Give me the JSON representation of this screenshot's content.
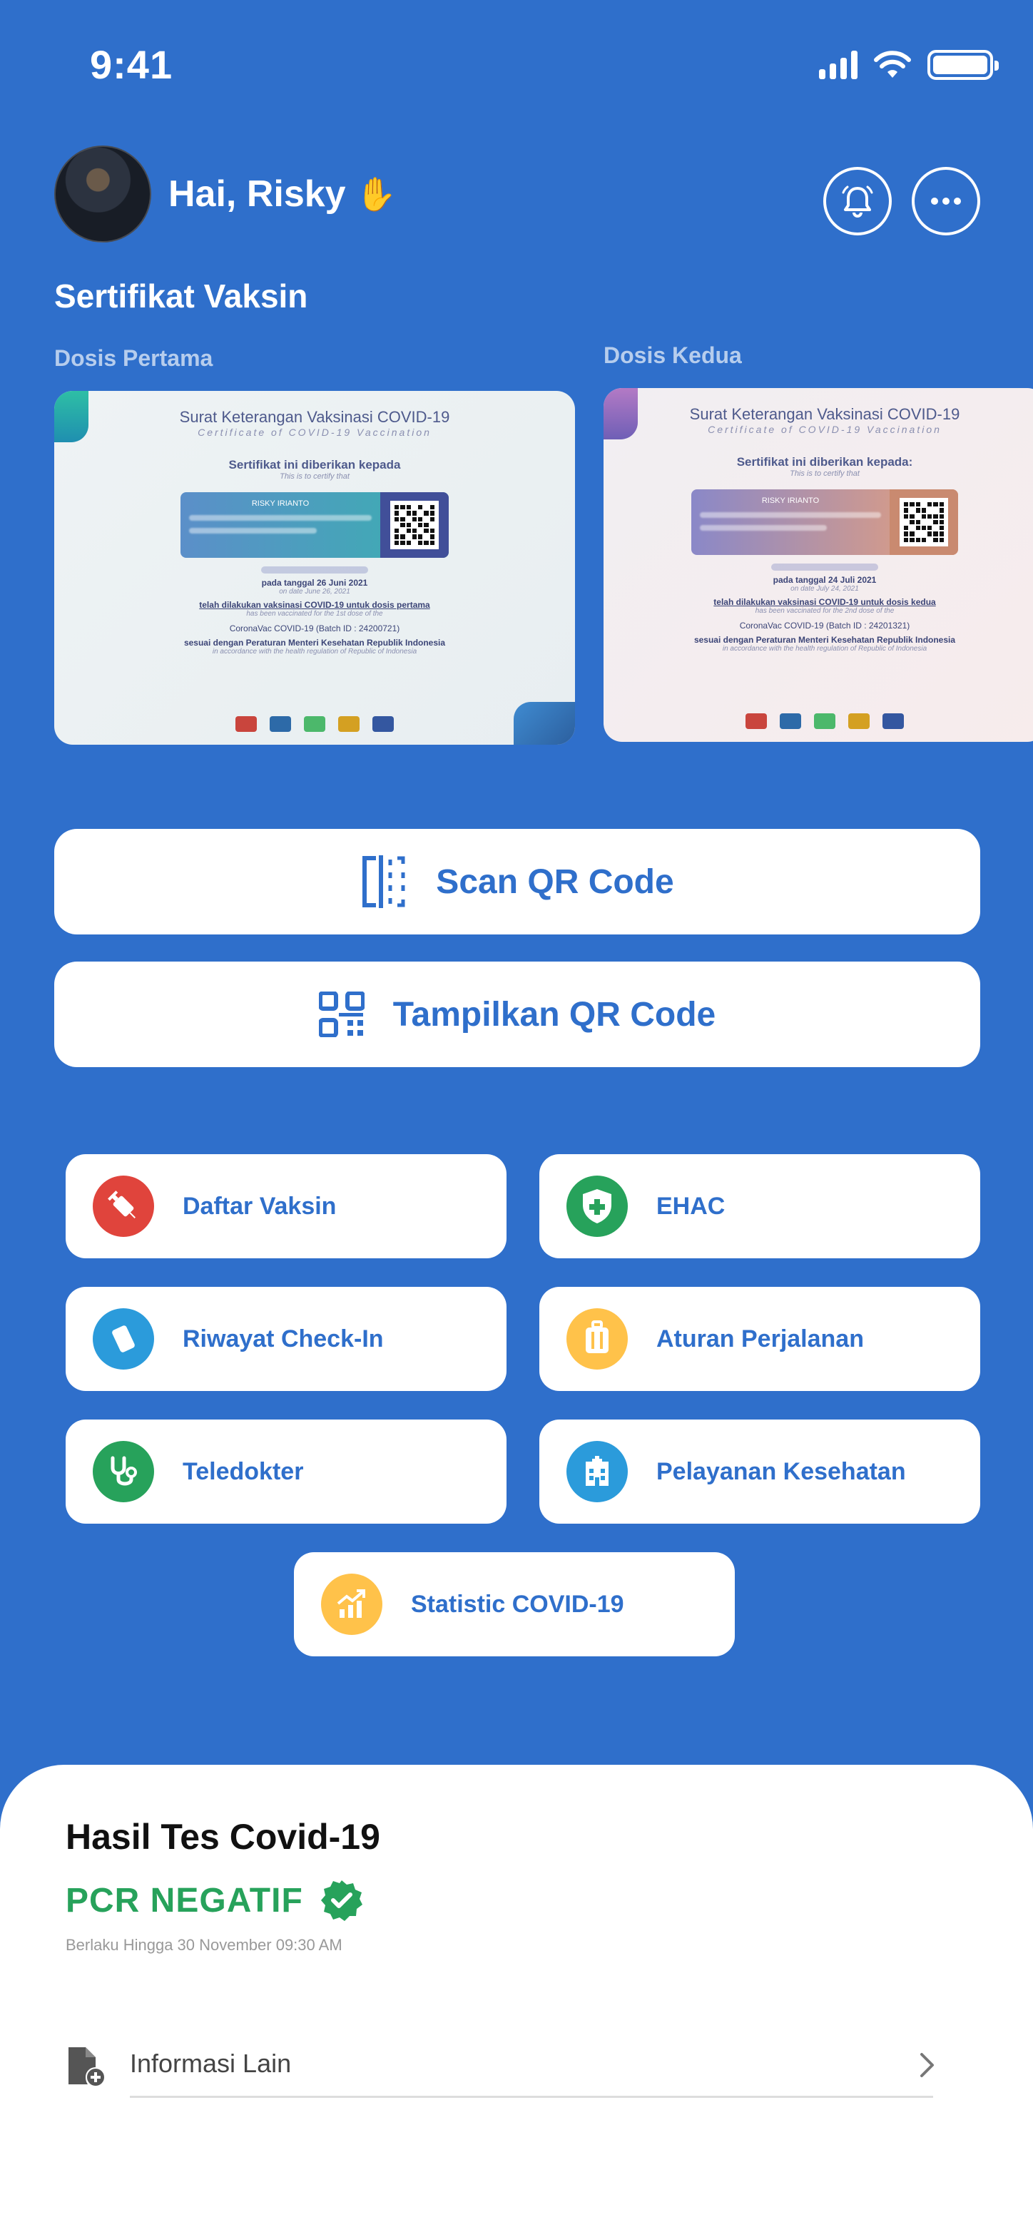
{
  "status_bar": {
    "time": "9:41"
  },
  "header": {
    "greeting": "Hai, Risky",
    "wave": "✋"
  },
  "section": {
    "title": "Sertifikat Vaksin",
    "dose1_label": "Dosis Pertama",
    "dose2_label": "Dosis Kedua"
  },
  "certificates": [
    {
      "title": "Surat Keterangan Vaksinasi COVID-19",
      "subtitle": "Certificate of COVID-19 Vaccination",
      "given": "Sertifikat ini diberikan kepada",
      "given_en": "This is to certify that",
      "name": "RISKY IRIANTO",
      "date": "pada tanggal 26 Juni 2021",
      "date_en": "on date June 26, 2021",
      "statement": "telah dilakukan vaksinasi COVID-19 untuk dosis pertama",
      "statement_en": "has been vaccinated for the 1st dose of the",
      "vaccine": "CoronaVac COVID-19 (Batch ID : 24200721)",
      "regulation": "sesuai dengan Peraturan Menteri Kesehatan Republik Indonesia",
      "regulation_en": "in accordance with the health regulation of Republic of Indonesia"
    },
    {
      "title": "Surat Keterangan Vaksinasi COVID-19",
      "subtitle": "Certificate of COVID-19 Vaccination",
      "given": "Sertifikat ini diberikan kepada:",
      "given_en": "This is to certify that",
      "name": "RISKY IRIANTO",
      "date": "pada tanggal 24 Juli 2021",
      "date_en": "on date July 24, 2021",
      "statement": "telah dilakukan vaksinasi COVID-19 untuk dosis kedua",
      "statement_en": "has been vaccinated for the 2nd dose of the",
      "vaccine": "CoronaVac COVID-19 (Batch ID : 24201321)",
      "regulation": "sesuai dengan Peraturan Menteri Kesehatan Republik Indonesia",
      "regulation_en": "in accordance with the health regulation of Republic of Indonesia"
    }
  ],
  "actions": {
    "scan_qr": "Scan QR Code",
    "show_qr": "Tampilkan QR Code"
  },
  "menu": {
    "daftar_vaksin": "Daftar Vaksin",
    "ehac": "EHAC",
    "riwayat_checkin": "Riwayat Check-In",
    "aturan_perjalanan": "Aturan Perjalanan",
    "teledokter": "Teledokter",
    "pelayanan_kesehatan": "Pelayanan Kesehatan",
    "statistic": "Statistic COVID-19"
  },
  "test_result": {
    "title": "Hasil Tes Covid-19",
    "status": "PCR NEGATIF",
    "valid_until": "Berlaku Hingga 30 November 09:30 AM",
    "more_info": "Informasi Lain"
  },
  "colors": {
    "primary": "#2F6FCB",
    "success": "#27A25B",
    "red_icon": "#E0443C",
    "green_icon": "#27A25B",
    "blue_icon": "#2B9BDB",
    "yellow_icon": "#FFC24A"
  }
}
